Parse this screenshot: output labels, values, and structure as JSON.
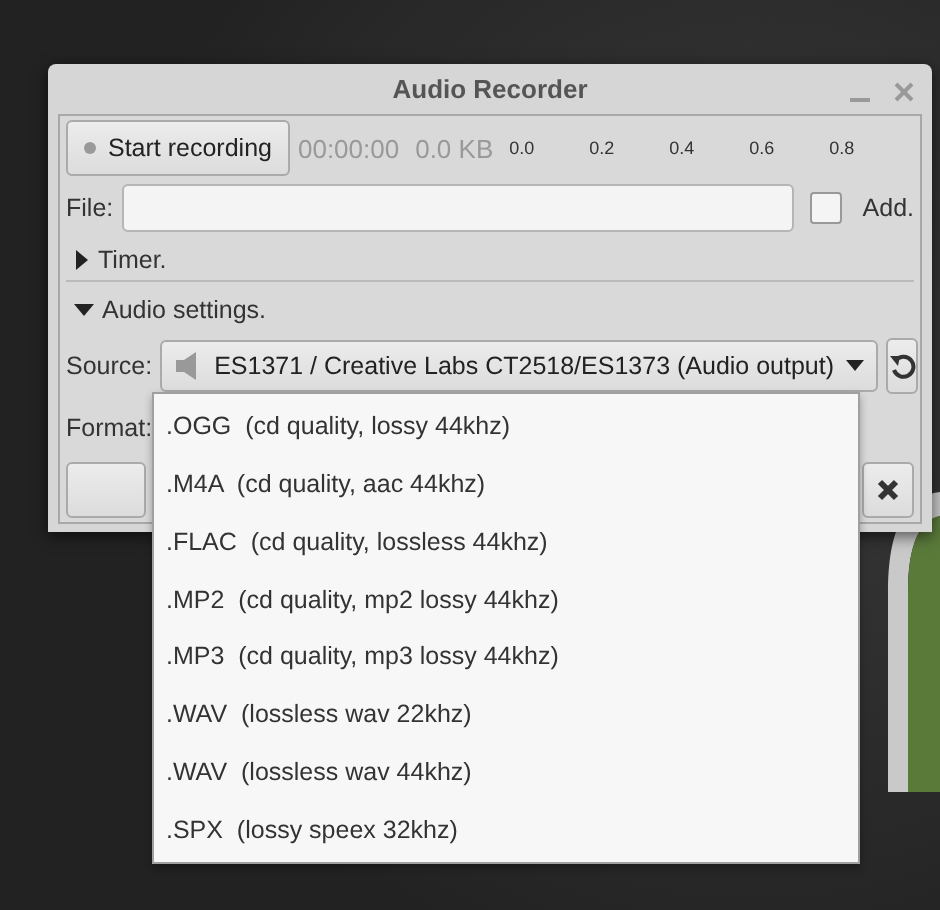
{
  "window": {
    "title": "Audio Recorder"
  },
  "toolbar": {
    "record_button": "Start recording",
    "time": "00:00:00",
    "size": "0.0 KB",
    "level_scale": [
      "0.0",
      "0.2",
      "0.4",
      "0.6",
      "0.8"
    ]
  },
  "file": {
    "label": "File:",
    "add_label": "Add.",
    "add_checked": false
  },
  "sections": [
    {
      "label": "Timer.",
      "expanded": false
    },
    {
      "label": "Audio settings.",
      "expanded": true
    }
  ],
  "source": {
    "label": "Source:",
    "value": "ES1371 / Creative Labs CT2518/ES1373 (Audio output)"
  },
  "format": {
    "label": "Format:",
    "options": [
      ".OGG  (cd quality, lossy 44khz)",
      ".M4A  (cd quality, aac 44khz)",
      ".FLAC  (cd quality, lossless 44khz)",
      ".MP2  (cd quality, mp2 lossy 44khz)",
      ".MP3  (cd quality, mp3 lossy 44khz)",
      ".WAV  (lossless wav 22khz)",
      ".WAV  (lossless wav 44khz)",
      ".SPX  (lossy speex 32khz)"
    ]
  }
}
